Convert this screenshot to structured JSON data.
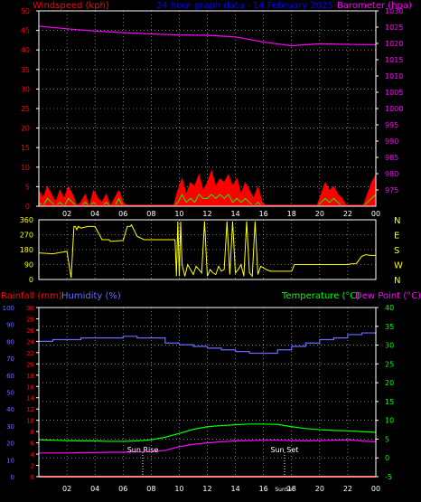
{
  "colors": {
    "background": "#000000",
    "frame": "#ffffff",
    "grid": "#ffffff",
    "windspeed": "#ff0000",
    "gust": "#00ff00",
    "barometer": "#ff00ff",
    "title": "#0000ff",
    "direction": "#ffff00",
    "rainfall": "#ff0000",
    "humidity": "#6a6aff",
    "temperature": "#00ff00",
    "dewpoint": "#ff00ff",
    "sun_markers": "#ffffff"
  },
  "chart_data": [
    {
      "type": "line",
      "title": "24 hour graph data - 14 February 2025",
      "ylabel_left": "Windspeed (kph)",
      "ylabel_right": "Barometer (hpa)",
      "ylim_left": [
        0,
        50
      ],
      "yticks_left": [
        "0",
        "5",
        "10",
        "15",
        "20",
        "25",
        "30",
        "35",
        "40",
        "45",
        "50"
      ],
      "ylim_right": [
        970,
        1030
      ],
      "yticks_right": [
        "975",
        "980",
        "985",
        "990",
        "995",
        "1000",
        "1005",
        "1010",
        "1015",
        "1020",
        "1025",
        "1030"
      ],
      "xlim": [
        0,
        24
      ],
      "xticks": [
        "02",
        "04",
        "06",
        "08",
        "10",
        "12",
        "14",
        "16",
        "18",
        "20",
        "22",
        "00"
      ],
      "grid": true,
      "series": [
        {
          "name": "Windspeed (kph)",
          "x": [
            0,
            0.3,
            0.6,
            0.9,
            1.2,
            1.5,
            1.8,
            2.1,
            2.4,
            2.7,
            3.0,
            3.3,
            3.6,
            3.9,
            4.2,
            4.5,
            4.8,
            5.1,
            5.4,
            5.7,
            6.0,
            6.3,
            6.6,
            6.9,
            7.2,
            7.5,
            7.8,
            8.1,
            8.4,
            8.7,
            9.0,
            9.3,
            9.6,
            9.9,
            10.2,
            10.5,
            10.8,
            11.1,
            11.4,
            11.7,
            12.0,
            12.3,
            12.6,
            12.9,
            13.2,
            13.5,
            13.8,
            14.1,
            14.4,
            14.7,
            15.0,
            15.3,
            15.6,
            15.9,
            16.2,
            16.5,
            16.8,
            17.1,
            17.4,
            17.7,
            18.0,
            18.3,
            18.6,
            18.9,
            19.2,
            19.5,
            19.8,
            20.1,
            20.4,
            20.7,
            21.0,
            21.3,
            21.6,
            21.9,
            22.2,
            22.5,
            22.8,
            23.1,
            23.4,
            23.7,
            24.0
          ],
          "y": [
            4,
            2,
            5,
            3,
            1,
            4,
            2,
            5,
            3,
            0,
            1,
            3,
            0,
            4,
            2,
            1,
            3,
            0,
            2,
            4,
            1,
            0,
            0,
            0,
            0,
            0,
            0,
            0,
            0,
            0,
            0,
            0,
            0,
            4,
            7,
            3,
            6,
            5,
            8,
            4,
            6,
            9,
            5,
            7,
            6,
            8,
            5,
            7,
            3,
            6,
            4,
            2,
            5,
            1,
            0,
            0,
            0,
            0,
            0,
            0,
            0,
            0,
            0,
            0,
            0,
            0,
            0,
            3,
            6,
            4,
            5,
            3,
            2,
            0,
            0,
            0,
            0,
            0,
            3,
            6,
            8
          ]
        },
        {
          "name": "Gust",
          "x": [
            0,
            0.3,
            0.6,
            0.9,
            1.2,
            1.5,
            1.8,
            2.1,
            2.4,
            2.7,
            3.0,
            3.3,
            3.6,
            3.9,
            4.2,
            4.5,
            4.8,
            5.1,
            5.4,
            5.7,
            6.0,
            6.3,
            6.6,
            6.9,
            7.2,
            7.5,
            7.8,
            8.1,
            8.4,
            8.7,
            9.0,
            9.3,
            9.6,
            9.9,
            10.2,
            10.5,
            10.8,
            11.1,
            11.4,
            11.7,
            12.0,
            12.3,
            12.6,
            12.9,
            13.2,
            13.5,
            13.8,
            14.1,
            14.4,
            14.7,
            15.0,
            15.3,
            15.6,
            15.9,
            16.2,
            16.5,
            16.8,
            17.1,
            17.4,
            17.7,
            18.0,
            18.3,
            18.6,
            18.9,
            19.2,
            19.5,
            19.8,
            20.1,
            20.4,
            20.7,
            21.0,
            21.3,
            21.6,
            21.9,
            22.2,
            22.5,
            22.8,
            23.1,
            23.4,
            23.7,
            24.0
          ],
          "y": [
            1,
            0,
            2,
            1,
            0,
            1,
            0,
            2,
            1,
            0,
            0,
            1,
            0,
            1,
            0,
            0,
            1,
            0,
            0,
            2,
            0,
            0,
            0,
            0,
            0,
            0,
            0,
            0,
            0,
            0,
            0,
            0,
            0,
            1,
            3,
            1,
            2,
            1,
            3,
            2,
            2,
            3,
            2,
            3,
            2,
            3,
            1,
            2,
            1,
            2,
            1,
            0,
            1,
            0,
            0,
            0,
            0,
            0,
            0,
            0,
            0,
            0,
            0,
            0,
            0,
            0,
            0,
            1,
            2,
            1,
            2,
            1,
            0,
            0,
            0,
            0,
            0,
            0,
            1,
            2,
            3
          ]
        },
        {
          "name": "Barometer (hpa)",
          "axis": "right",
          "x": [
            0,
            2,
            4,
            6,
            8,
            10,
            12,
            14,
            16,
            18,
            20,
            22,
            24
          ],
          "y": [
            1025.3,
            1024.5,
            1023.8,
            1023.3,
            1022.9,
            1022.6,
            1022.5,
            1022.0,
            1020.4,
            1019.3,
            1019.9,
            1019.7,
            1019.6
          ]
        }
      ]
    },
    {
      "type": "line",
      "ylim": [
        0,
        360
      ],
      "yticks_left": [
        "0",
        "90",
        "180",
        "270",
        "360"
      ],
      "yticks_right": [
        "N",
        "W",
        "S",
        "E",
        "N"
      ],
      "xlim": [
        0,
        24
      ],
      "grid": true,
      "series": [
        {
          "name": "Wind direction",
          "x": [
            0,
            1.0,
            2.0,
            2.3,
            2.5,
            2.6,
            2.7,
            2.8,
            3.0,
            3.5,
            4.0,
            4.5,
            5.0,
            5.1,
            6.0,
            6.3,
            6.5,
            6.6,
            7.0,
            7.5,
            8.0,
            9.0,
            9.5,
            9.7,
            9.8,
            9.9,
            10.0,
            10.1,
            10.2,
            10.4,
            10.6,
            10.8,
            11.0,
            11.2,
            11.4,
            11.6,
            11.8,
            12.0,
            12.2,
            12.4,
            12.6,
            12.8,
            13.0,
            13.2,
            13.4,
            13.6,
            13.8,
            14.0,
            14.2,
            14.4,
            14.6,
            14.8,
            15.0,
            15.2,
            15.4,
            15.6,
            15.8,
            16.0,
            16.2,
            16.5,
            17.0,
            17.5,
            18.0,
            18.2,
            19.0,
            20.0,
            21.0,
            21.5,
            22.0,
            22.3,
            22.6,
            23.0,
            23.3,
            23.6,
            24.0
          ],
          "y": [
            160,
            155,
            170,
            10,
            320,
            320,
            300,
            320,
            310,
            320,
            320,
            240,
            240,
            230,
            235,
            320,
            320,
            330,
            260,
            240,
            240,
            240,
            240,
            240,
            20,
            350,
            20,
            350,
            90,
            20,
            90,
            60,
            30,
            80,
            60,
            40,
            350,
            20,
            60,
            40,
            30,
            80,
            50,
            60,
            350,
            30,
            350,
            40,
            60,
            90,
            20,
            350,
            40,
            20,
            350,
            30,
            80,
            70,
            60,
            50,
            50,
            50,
            50,
            90,
            90,
            90,
            90,
            90,
            90,
            95,
            95,
            140,
            150,
            145,
            145
          ]
        }
      ]
    },
    {
      "type": "line",
      "ylabel_left": "Rainfall (mm)",
      "ylabel_left_2": "Humidity (%)",
      "ylabel_right": "Temperature (°C)",
      "ylabel_right_2": "Dew Point (°C)",
      "yticks_humidity": [
        "0",
        "10",
        "20",
        "30",
        "40",
        "50",
        "60",
        "70",
        "80",
        "90",
        "100"
      ],
      "yticks_rainfall": [
        "0",
        "2",
        "4",
        "6",
        "8",
        "10",
        "12",
        "14",
        "16",
        "18",
        "20",
        "22",
        "24",
        "26",
        "28",
        "30"
      ],
      "yticks_temperature": [
        "-5",
        "0",
        "5",
        "10",
        "15",
        "20",
        "25",
        "30",
        "35",
        "40"
      ],
      "ylim_humidity": [
        0,
        100
      ],
      "ylim_rainfall": [
        0,
        30
      ],
      "ylim_temperature": [
        -5,
        40
      ],
      "xlim": [
        0,
        24
      ],
      "xticks": [
        "02",
        "04",
        "06",
        "08",
        "10",
        "12",
        "14",
        "16",
        "18",
        "20",
        "22",
        "00"
      ],
      "grid": true,
      "annotations": [
        {
          "label": "Sun Rise",
          "x": 7.4
        },
        {
          "label": "Sun Set",
          "x": 17.5
        }
      ],
      "sunset_tick": "SunSet",
      "series": [
        {
          "name": "Humidity (%)",
          "x": [
            0,
            1,
            2,
            3,
            4,
            5,
            6,
            7,
            8,
            9,
            10,
            11,
            12,
            13,
            14,
            15,
            16,
            17,
            18,
            19,
            20,
            21,
            22,
            23,
            24
          ],
          "y": [
            80,
            81,
            81,
            82,
            82,
            82,
            83,
            82,
            82,
            79,
            78,
            77,
            76,
            75,
            74,
            73,
            73,
            75,
            77,
            79,
            81,
            82,
            84,
            85,
            84
          ]
        },
        {
          "name": "Temperature (°C)",
          "x": [
            0,
            1,
            2,
            3,
            4,
            5,
            6,
            7,
            8,
            9,
            10,
            11,
            12,
            13,
            14,
            15,
            16,
            17,
            18,
            19,
            20,
            21,
            22,
            23,
            24
          ],
          "y": [
            4.8,
            4.7,
            4.6,
            4.5,
            4.5,
            4.4,
            4.4,
            4.5,
            4.8,
            5.5,
            6.5,
            7.6,
            8.3,
            8.6,
            8.8,
            9.0,
            9.0,
            8.9,
            8.3,
            7.8,
            7.5,
            7.3,
            7.2,
            7.0,
            6.8
          ]
        },
        {
          "name": "Dew Point (°C)",
          "x": [
            0,
            1,
            2,
            3,
            4,
            5,
            6,
            7,
            8,
            9,
            10,
            11,
            12,
            13,
            14,
            15,
            16,
            17,
            18,
            19,
            20,
            21,
            22,
            23,
            24
          ],
          "y": [
            1.3,
            1.3,
            1.3,
            1.4,
            1.4,
            1.5,
            1.5,
            1.6,
            1.6,
            2.0,
            3.0,
            3.6,
            4.0,
            4.3,
            4.5,
            4.6,
            4.7,
            4.7,
            4.6,
            4.5,
            4.6,
            4.7,
            4.8,
            4.5,
            4.3
          ]
        },
        {
          "name": "Rainfall (mm)",
          "x": [
            0,
            24
          ],
          "y": [
            0,
            0
          ]
        }
      ]
    }
  ]
}
